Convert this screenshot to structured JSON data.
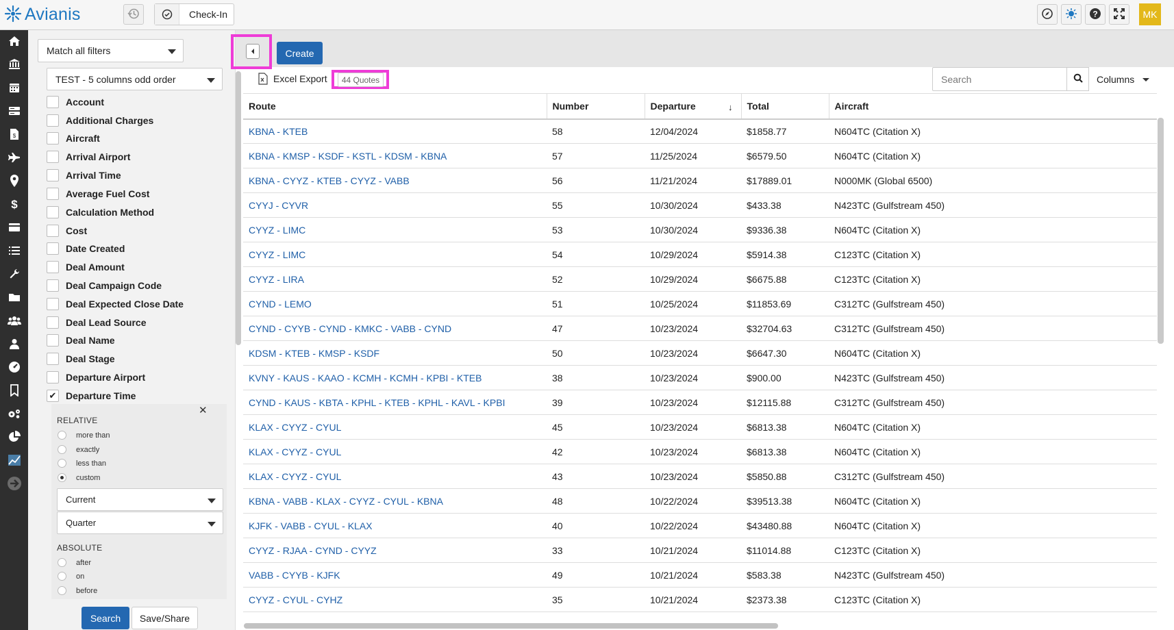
{
  "app": {
    "name": "Avianis",
    "user_initials": "MK"
  },
  "topbar": {
    "checkin_label": "Check-In"
  },
  "filters": {
    "match_mode": "Match all filters",
    "saved_view": "TEST - 5 columns odd order",
    "fields": [
      {
        "label": "Account",
        "checked": false
      },
      {
        "label": "Additional Charges",
        "checked": false
      },
      {
        "label": "Aircraft",
        "checked": false
      },
      {
        "label": "Arrival Airport",
        "checked": false
      },
      {
        "label": "Arrival Time",
        "checked": false
      },
      {
        "label": "Average Fuel Cost",
        "checked": false
      },
      {
        "label": "Calculation Method",
        "checked": false
      },
      {
        "label": "Cost",
        "checked": false
      },
      {
        "label": "Date Created",
        "checked": false
      },
      {
        "label": "Deal Amount",
        "checked": false
      },
      {
        "label": "Deal Campaign Code",
        "checked": false
      },
      {
        "label": "Deal Expected Close Date",
        "checked": false
      },
      {
        "label": "Deal Lead Source",
        "checked": false
      },
      {
        "label": "Deal Name",
        "checked": false
      },
      {
        "label": "Deal Stage",
        "checked": false
      },
      {
        "label": "Departure Airport",
        "checked": false
      },
      {
        "label": "Departure Time",
        "checked": true
      }
    ],
    "departure_time": {
      "relative_heading": "RELATIVE",
      "relative_options": [
        "more than",
        "exactly",
        "less than",
        "custom"
      ],
      "relative_selected": "custom",
      "period": "Current",
      "unit": "Quarter",
      "absolute_heading": "ABSOLUTE",
      "absolute_options": [
        "after",
        "on",
        "before"
      ]
    },
    "search_label": "Search",
    "save_label": "Save/Share"
  },
  "main": {
    "create_label": "Create",
    "excel_label": "Excel Export",
    "count_label": "44 Quotes",
    "search_placeholder": "Search",
    "columns_label": "Columns",
    "headers": [
      "Route",
      "Number",
      "Departure",
      "Total",
      "Aircraft"
    ],
    "sort_column": "Departure",
    "rows": [
      [
        "KBNA - KTEB",
        "58",
        "12/04/2024",
        "$1858.77",
        "N604TC (Citation X)"
      ],
      [
        "KBNA - KMSP - KSDF - KSTL - KDSM - KBNA",
        "57",
        "11/25/2024",
        "$6579.50",
        "N604TC (Citation X)"
      ],
      [
        "KBNA - CYYZ - KTEB - CYYZ - VABB",
        "56",
        "11/21/2024",
        "$17889.01",
        "N000MK (Global 6500)"
      ],
      [
        "CYYJ - CYVR",
        "55",
        "10/30/2024",
        "$433.38",
        "N423TC (Gulfstream 450)"
      ],
      [
        "CYYZ - LIMC",
        "53",
        "10/30/2024",
        "$9336.38",
        "N604TC (Citation X)"
      ],
      [
        "CYYZ - LIMC",
        "54",
        "10/29/2024",
        "$5914.38",
        "C123TC (Citation X)"
      ],
      [
        "CYYZ - LIRA",
        "52",
        "10/29/2024",
        "$6675.88",
        "C123TC (Citation X)"
      ],
      [
        "CYND - LEMO",
        "51",
        "10/25/2024",
        "$11853.69",
        "C312TC (Gulfstream 450)"
      ],
      [
        "CYND - CYYB - CYND - KMKC - VABB - CYND",
        "47",
        "10/23/2024",
        "$32704.63",
        "C312TC (Gulfstream 450)"
      ],
      [
        "KDSM - KTEB - KMSP - KSDF",
        "50",
        "10/23/2024",
        "$6647.30",
        "N604TC (Citation X)"
      ],
      [
        "KVNY - KAUS - KAAO - KCMH - KCMH - KPBI - KTEB",
        "38",
        "10/23/2024",
        "$900.00",
        "N423TC (Gulfstream 450)"
      ],
      [
        "CYND - KAUS - KBTA - KPHL - KTEB - KPHL - KAVL - KPBI",
        "39",
        "10/23/2024",
        "$12115.88",
        "C312TC (Gulfstream 450)"
      ],
      [
        "KLAX - CYYZ - CYUL",
        "45",
        "10/23/2024",
        "$6813.38",
        "N604TC (Citation X)"
      ],
      [
        "KLAX - CYYZ - CYUL",
        "42",
        "10/23/2024",
        "$6813.38",
        "N604TC (Citation X)"
      ],
      [
        "KLAX - CYYZ - CYUL",
        "43",
        "10/23/2024",
        "$5850.88",
        "C312TC (Gulfstream 450)"
      ],
      [
        "KBNA - VABB - KLAX - CYYZ - CYUL - KBNA",
        "48",
        "10/22/2024",
        "$39513.38",
        "N604TC (Citation X)"
      ],
      [
        "KJFK - VABB - CYUL - KLAX",
        "40",
        "10/22/2024",
        "$43480.88",
        "N604TC (Citation X)"
      ],
      [
        "CYYZ - RJAA - CYND - CYYZ",
        "33",
        "10/21/2024",
        "$11014.88",
        "C123TC (Citation X)"
      ],
      [
        "VABB - CYYB - KJFK",
        "49",
        "10/21/2024",
        "$583.38",
        "N423TC (Gulfstream 450)"
      ],
      [
        "CYYZ - CYUL - CYHZ",
        "35",
        "10/21/2024",
        "$2373.38",
        "C123TC (Citation X)"
      ]
    ]
  },
  "colors": {
    "accent": "#2468b1",
    "link": "#1f5fa8",
    "highlight": "#ee3cd7",
    "nav_bg": "#2f2f2f",
    "avatar": "#e3b81a"
  }
}
